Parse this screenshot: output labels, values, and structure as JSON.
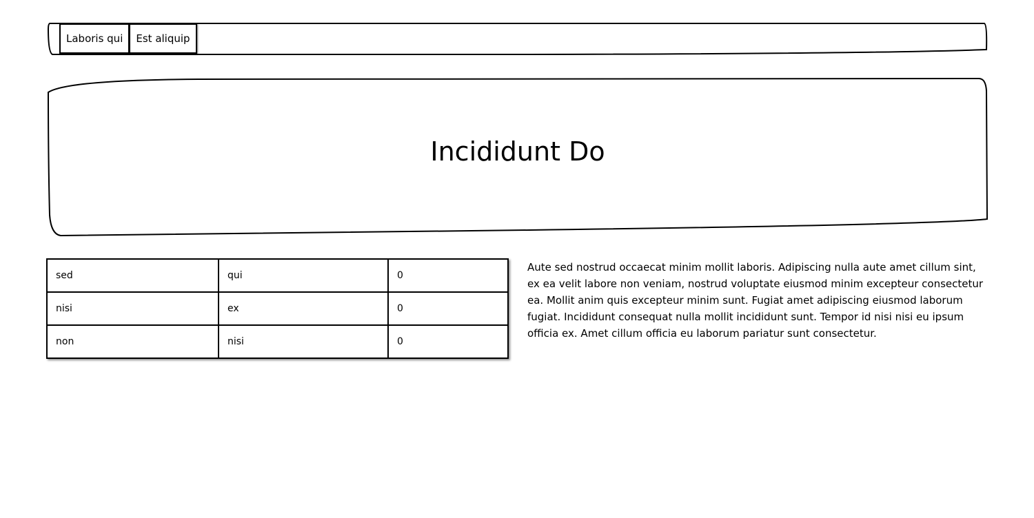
{
  "nav": {
    "tabs": [
      "Laboris qui",
      "Est aliquip"
    ]
  },
  "hero": {
    "title": "Incididunt Do"
  },
  "table": {
    "rows": [
      [
        "sed",
        "qui",
        "0"
      ],
      [
        "nisi",
        "ex",
        "0"
      ],
      [
        "non",
        "nisi",
        "0"
      ]
    ]
  },
  "paragraph": "Aute sed nostrud occaecat minim mollit laboris. Adipiscing nulla aute amet cillum sint, ex ea velit labore non veniam, nostrud voluptate eiusmod minim excepteur consectetur ea. Mollit anim quis excepteur minim sunt. Fugiat amet adipiscing eiusmod laborum fugiat. Incididunt consequat nulla mollit incididunt sunt. Tempor id nisi nisi eu ipsum officia ex. Amet cillum officia eu laborum pariatur sunt consectetur."
}
